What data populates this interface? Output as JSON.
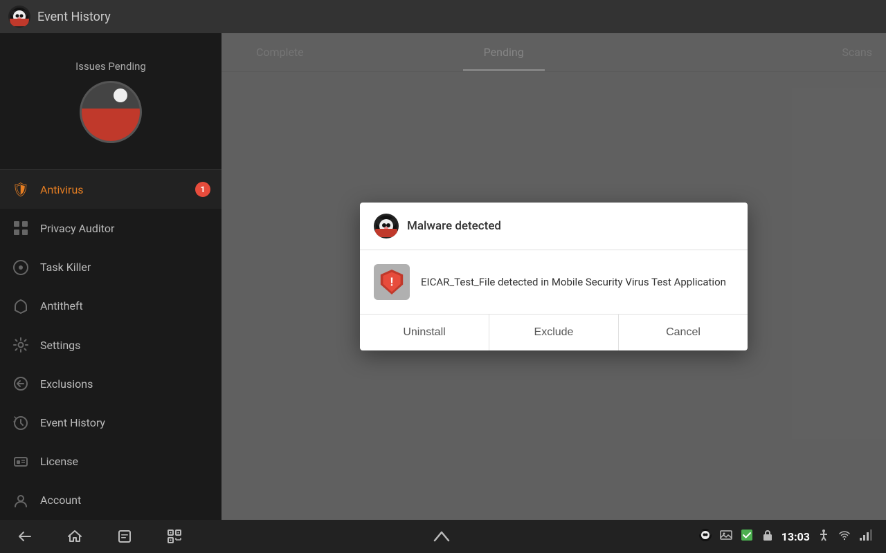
{
  "topBar": {
    "title": "Event History"
  },
  "sidebar": {
    "statusLabel": "Issues Pending",
    "navItems": [
      {
        "id": "antivirus",
        "label": "Antivirus",
        "icon": "shield",
        "active": true,
        "badge": "1"
      },
      {
        "id": "privacy-auditor",
        "label": "Privacy Auditor",
        "icon": "grid",
        "active": false,
        "badge": null
      },
      {
        "id": "task-killer",
        "label": "Task Killer",
        "icon": "circle",
        "active": false,
        "badge": null
      },
      {
        "id": "antitheft",
        "label": "Antitheft",
        "icon": "key",
        "active": false,
        "badge": null
      },
      {
        "id": "settings",
        "label": "Settings",
        "icon": "gear",
        "active": false,
        "badge": null
      },
      {
        "id": "exclusions",
        "label": "Exclusions",
        "icon": "arrow-left",
        "active": false,
        "badge": null
      },
      {
        "id": "event-history",
        "label": "Event History",
        "icon": "history",
        "active": false,
        "badge": null
      },
      {
        "id": "license",
        "label": "License",
        "icon": "card",
        "active": false,
        "badge": null
      },
      {
        "id": "account",
        "label": "Account",
        "icon": "user",
        "active": false,
        "badge": null
      }
    ]
  },
  "tabs": [
    {
      "id": "complete",
      "label": "Complete",
      "active": false
    },
    {
      "id": "pending",
      "label": "Pending",
      "active": true
    },
    {
      "id": "scans",
      "label": "Scans",
      "active": false
    }
  ],
  "modal": {
    "title": "Malware detected",
    "message": "EICAR_Test_File detected in Mobile Security Virus Test Application",
    "buttons": [
      {
        "id": "uninstall",
        "label": "Uninstall"
      },
      {
        "id": "exclude",
        "label": "Exclude"
      },
      {
        "id": "cancel",
        "label": "Cancel"
      }
    ]
  },
  "bottomBar": {
    "time": "13:03",
    "navButtons": [
      "back",
      "home",
      "recents",
      "qr"
    ]
  }
}
